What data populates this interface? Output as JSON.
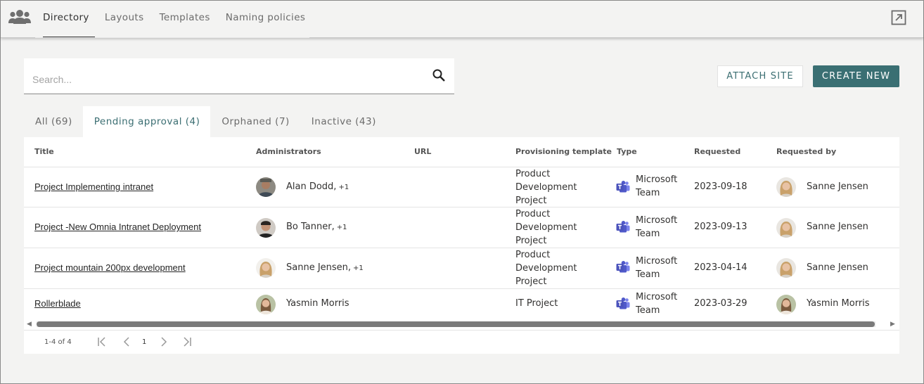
{
  "nav": {
    "app_icon": "people-group-icon",
    "tabs": [
      {
        "label": "Directory",
        "active": true
      },
      {
        "label": "Layouts",
        "active": false
      },
      {
        "label": "Templates",
        "active": false
      },
      {
        "label": "Naming policies",
        "active": false
      }
    ],
    "expand_icon": "open-external-icon"
  },
  "search": {
    "placeholder": "Search...",
    "value": "",
    "icon": "search-icon"
  },
  "actions": {
    "attach_label": "ATTACH SITE",
    "create_label": "CREATE NEW"
  },
  "tabs": [
    {
      "label": "All (69)",
      "active": false
    },
    {
      "label": "Pending approval (4)",
      "active": true
    },
    {
      "label": "Orphaned (7)",
      "active": false
    },
    {
      "label": "Inactive (43)",
      "active": false
    }
  ],
  "table": {
    "headers": {
      "title": "Title",
      "admins": "Administrators",
      "url": "URL",
      "template": "Provisioning template",
      "type": "Type",
      "requested": "Requested",
      "requested_by": "Requested by"
    },
    "rows": [
      {
        "title": "Project Implementing intranet",
        "admin": "Alan Dodd,",
        "admin_extra": "+1",
        "url": "",
        "template": "Product Development Project",
        "type": "Microsoft Team",
        "requested": "2023-09-18",
        "requested_by": "Sanne Jensen"
      },
      {
        "title": "Project -New Omnia Intranet Deployment",
        "admin": "Bo Tanner,",
        "admin_extra": "+1",
        "url": "",
        "template": "Product Development Project",
        "type": "Microsoft Team",
        "requested": "2023-09-13",
        "requested_by": "Sanne Jensen"
      },
      {
        "title": "Project mountain 200px development",
        "admin": "Sanne Jensen,",
        "admin_extra": "+1",
        "url": "",
        "template": "Product Development Project",
        "type": "Microsoft Team",
        "requested": "2023-04-14",
        "requested_by": "Sanne Jensen"
      },
      {
        "title": "Rollerblade",
        "admin": "Yasmin Morris",
        "admin_extra": "",
        "url": "",
        "template": "IT Project",
        "type": "Microsoft Team",
        "requested": "2023-03-29",
        "requested_by": "Yasmin Morris"
      }
    ]
  },
  "pager": {
    "info": "1-4 of 4",
    "page": "1"
  },
  "colors": {
    "accent": "#3a6f73",
    "teams": "#5059c9",
    "background": "#f3f3f2"
  }
}
